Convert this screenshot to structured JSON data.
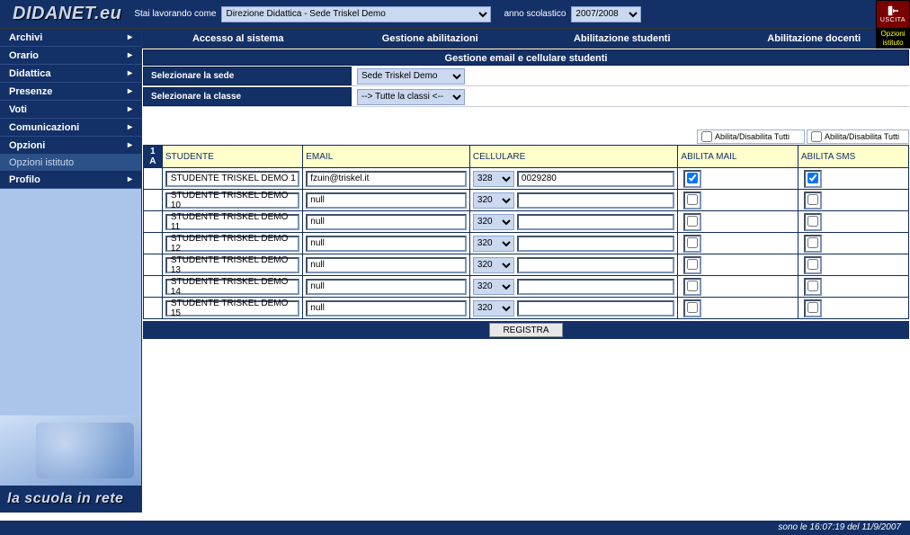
{
  "brand": "DIDANET.eu",
  "slogan": "la scuola in rete",
  "top": {
    "working_as_label": "Stai lavorando come",
    "sede_selected": "Direzione Didattica - Sede Triskel Demo",
    "year_label": "anno scolastico",
    "year_selected": "2007/2008",
    "uscita": "USCITA",
    "opzioni_corner": "Opzioni istituto"
  },
  "sidebar": {
    "items": [
      {
        "label": "Archivi"
      },
      {
        "label": "Orario"
      },
      {
        "label": "Didattica"
      },
      {
        "label": "Presenze"
      },
      {
        "label": "Voti"
      },
      {
        "label": "Comunicazioni"
      },
      {
        "label": "Opzioni"
      }
    ],
    "sub_item": "Opzioni istituto",
    "profilo": "Profilo"
  },
  "tabs": [
    "Accesso al sistema",
    "Gestione abilitazioni",
    "Abilitazione studenti",
    "Abilitazione docenti"
  ],
  "page_title": "Gestione email e cellulare studenti",
  "selectors": {
    "sede_label": "Selezionare la sede",
    "sede_value": "Sede Triskel Demo",
    "classe_label": "Selezionare la classe",
    "classe_value": "--> Tutte la classi <--"
  },
  "toggle_all_label": "Abilita/Disabilita Tutti",
  "grid": {
    "corner": "1 A",
    "headers": {
      "studente": "STUDENTE",
      "email": "EMAIL",
      "cellulare": "CELLULARE",
      "abilita_mail": "ABILITA MAIL",
      "abilita_sms": "ABILITA SMS"
    },
    "rows": [
      {
        "name": "STUDENTE TRISKEL DEMO 1",
        "email": "fzuin@triskel.it",
        "prefix": "328",
        "cell": "0029280",
        "mail": true,
        "sms": true
      },
      {
        "name": "STUDENTE TRISKEL DEMO 10",
        "email": "null",
        "prefix": "320",
        "cell": "",
        "mail": false,
        "sms": false
      },
      {
        "name": "STUDENTE TRISKEL DEMO 11",
        "email": "null",
        "prefix": "320",
        "cell": "",
        "mail": false,
        "sms": false
      },
      {
        "name": "STUDENTE TRISKEL DEMO 12",
        "email": "null",
        "prefix": "320",
        "cell": "",
        "mail": false,
        "sms": false
      },
      {
        "name": "STUDENTE TRISKEL DEMO 13",
        "email": "null",
        "prefix": "320",
        "cell": "",
        "mail": false,
        "sms": false
      },
      {
        "name": "STUDENTE TRISKEL DEMO 14",
        "email": "null",
        "prefix": "320",
        "cell": "",
        "mail": false,
        "sms": false
      },
      {
        "name": "STUDENTE TRISKEL DEMO 15",
        "email": "null",
        "prefix": "320",
        "cell": "",
        "mail": false,
        "sms": false
      }
    ]
  },
  "registra": "REGISTRA",
  "footer": "sono le 16:07:19 del 11/9/2007"
}
